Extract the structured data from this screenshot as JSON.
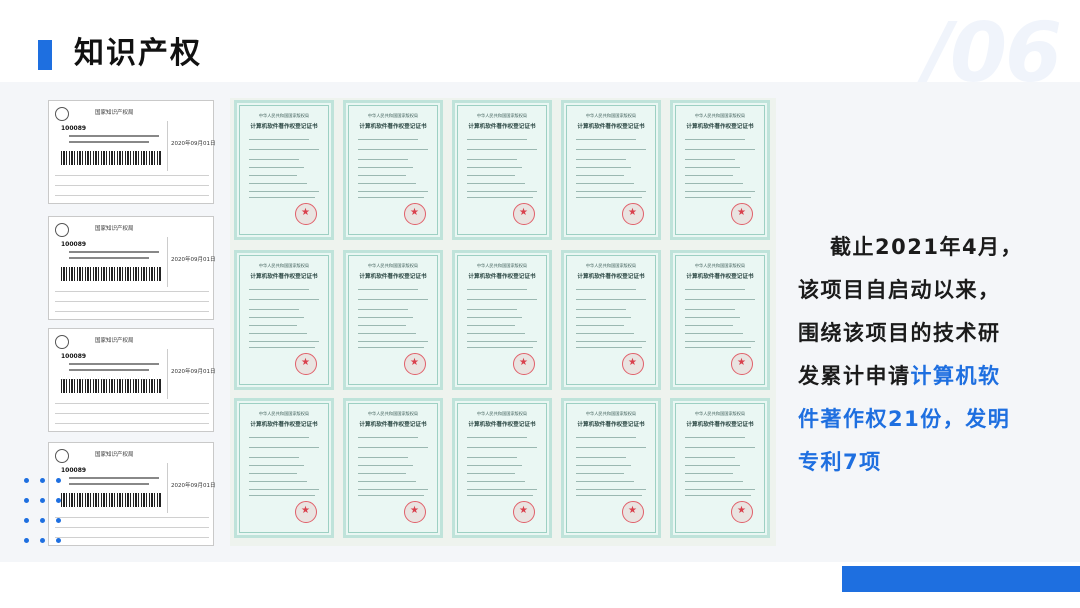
{
  "header": {
    "title": "知识产权",
    "watermark": "/06"
  },
  "notices": [
    {
      "heading": "国家知识产权局",
      "code": "100089",
      "date": "2020年09月01日"
    },
    {
      "heading": "国家知识产权局",
      "code": "100089",
      "date": "2020年09月01日"
    },
    {
      "heading": "国家知识产权局",
      "code": "100089",
      "date": "2020年09月01日"
    },
    {
      "heading": "国家知识产权局",
      "code": "100089",
      "date": "2020年09月01日"
    }
  ],
  "certificates": {
    "header": "中华人民共和国国家版权局",
    "title": "计算机软件著作权登记证书"
  },
  "summary": {
    "line1": "截止2021年4月，",
    "line2": "该项目自启动以来，",
    "line3": "围绕该项目的技术研",
    "line4_prefix": "发累计申请",
    "highlight1": "计算机软",
    "highlight2": "件著作权21份，发明",
    "highlight3": "专利7项"
  },
  "colors": {
    "accent": "#1e6fe0",
    "text": "#1b1b1b",
    "band": "#f4f6f9"
  }
}
